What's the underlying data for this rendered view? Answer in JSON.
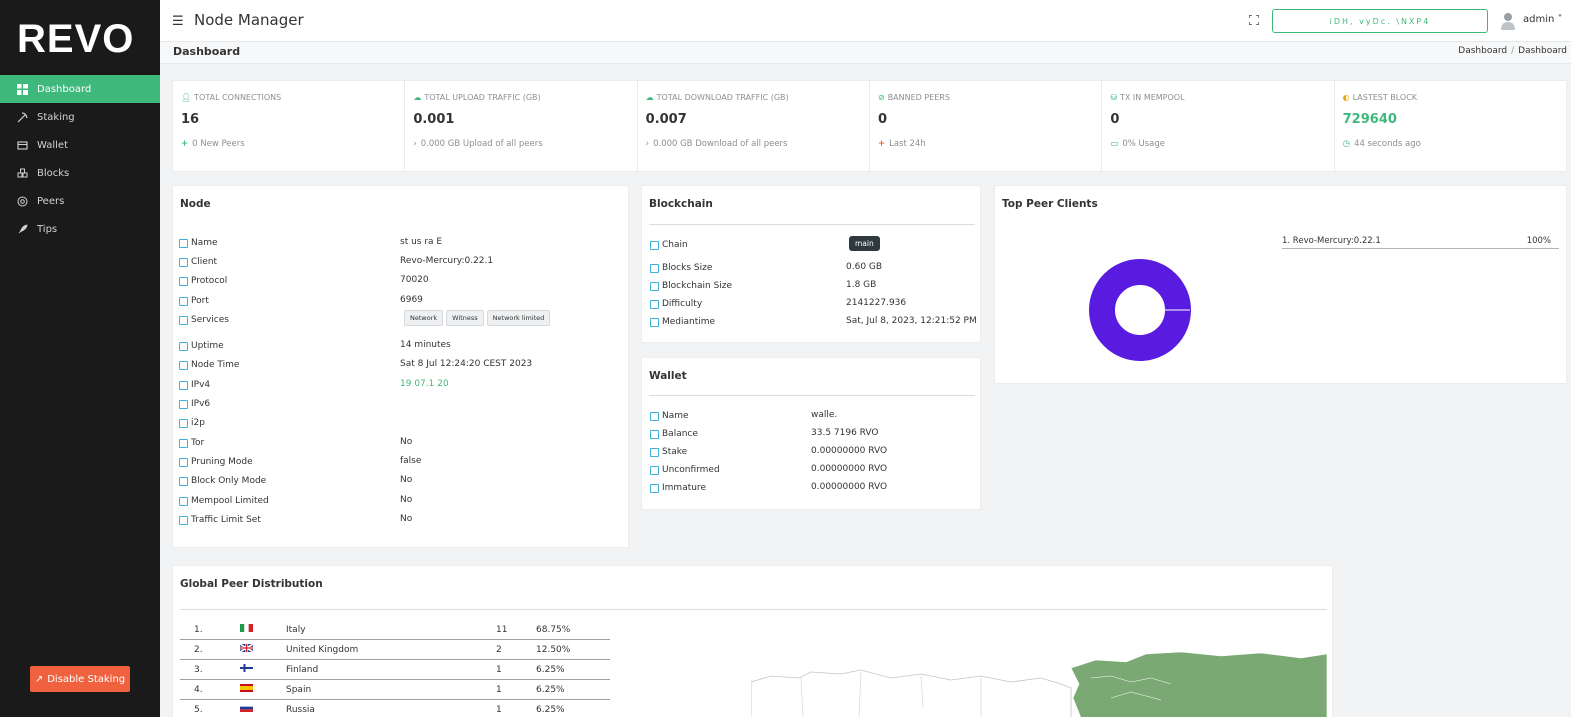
{
  "brand": {
    "logo_text": "REVO"
  },
  "sidebar": {
    "items": [
      {
        "label": "Dashboard",
        "icon": "dashboard-icon"
      },
      {
        "label": "Staking",
        "icon": "pickaxe-icon"
      },
      {
        "label": "Wallet",
        "icon": "wallet-icon"
      },
      {
        "label": "Blocks",
        "icon": "cubes-icon"
      },
      {
        "label": "Peers",
        "icon": "peers-icon"
      },
      {
        "label": "Tips",
        "icon": "rocket-icon"
      }
    ],
    "disable_staking_label": "Disable Staking"
  },
  "header": {
    "title": "Node Manager",
    "address_label": "iDH,  vyDc.    \\NXP4",
    "user": "admin"
  },
  "breadcrumb": {
    "page_title": "Dashboard",
    "crumb1": "Dashboard",
    "crumb2": "Dashboard"
  },
  "stats": [
    {
      "label": "TOTAL CONNECTIONS",
      "value": "16",
      "sub": "0 New Peers"
    },
    {
      "label": "TOTAL UPLOAD TRAFFIC (GB)",
      "value": "0.001",
      "sub": "0.000 GB Upload of all peers"
    },
    {
      "label": "TOTAL DOWNLOAD TRAFFIC (GB)",
      "value": "0.007",
      "sub": "0.000 GB Download of all peers"
    },
    {
      "label": "BANNED PEERS",
      "value": "0",
      "sub": "Last 24h"
    },
    {
      "label": "TX IN MEMPOOL",
      "value": "0",
      "sub": "0% Usage"
    },
    {
      "label": "LASTEST BLOCK",
      "value": "729640",
      "sub": "44 seconds ago"
    }
  ],
  "node": {
    "title": "Node",
    "rows": [
      {
        "label": "Name",
        "value": "st  us  ra  E"
      },
      {
        "label": "Client",
        "value": "Revo-Mercury:0.22.1"
      },
      {
        "label": "Protocol",
        "value": "70020"
      },
      {
        "label": "Port",
        "value": "6969"
      },
      {
        "label": "Services",
        "value": ""
      },
      {
        "label": "Uptime",
        "value": "14 minutes"
      },
      {
        "label": "Node Time",
        "value": "Sat 8 Jul 12:24:20 CEST 2023"
      },
      {
        "label": "IPv4",
        "value": "19   07.1   20"
      },
      {
        "label": "IPv6",
        "value": ""
      },
      {
        "label": "i2p",
        "value": ""
      },
      {
        "label": "Tor",
        "value": "No"
      },
      {
        "label": "Pruning Mode",
        "value": "false"
      },
      {
        "label": "Block Only Mode",
        "value": "No"
      },
      {
        "label": "Mempool Limited",
        "value": "No"
      },
      {
        "label": "Traffic Limit Set",
        "value": "No"
      }
    ],
    "services": [
      "Network",
      "Witness",
      "Network limited"
    ]
  },
  "blockchain": {
    "title": "Blockchain",
    "rows": [
      {
        "label": "Chain",
        "value": "main"
      },
      {
        "label": "Blocks Size",
        "value": "0.60 GB"
      },
      {
        "label": "Blockchain Size",
        "value": "1.8 GB"
      },
      {
        "label": "Difficulty",
        "value": "2141227.936"
      },
      {
        "label": "Mediantime",
        "value": "Sat, Jul 8, 2023, 12:21:52 PM"
      }
    ]
  },
  "wallet": {
    "title": "Wallet",
    "rows": [
      {
        "label": "Name",
        "value": "walle."
      },
      {
        "label": "Balance",
        "value": "33.5     7196 RVO"
      },
      {
        "label": "Stake",
        "value": "0.00000000 RVO"
      },
      {
        "label": "Unconfirmed",
        "value": "0.00000000 RVO"
      },
      {
        "label": "Immature",
        "value": "0.00000000 RVO"
      }
    ]
  },
  "top_peers": {
    "title": "Top Peer Clients",
    "legend_label": "1. Revo-Mercury:0.22.1",
    "legend_pct": "100%",
    "color": "#5a1be0"
  },
  "global": {
    "title": "Global Peer Distribution",
    "rows": [
      {
        "rank": "1.",
        "country": "Italy",
        "count": "11",
        "pct": "68.75%"
      },
      {
        "rank": "2.",
        "country": "United Kingdom",
        "count": "2",
        "pct": "12.50%"
      },
      {
        "rank": "3.",
        "country": "Finland",
        "count": "1",
        "pct": "6.25%"
      },
      {
        "rank": "4.",
        "country": "Spain",
        "count": "1",
        "pct": "6.25%"
      },
      {
        "rank": "5.",
        "country": "Russia",
        "count": "1",
        "pct": "6.25%"
      }
    ]
  },
  "colors": {
    "accent": "#3fb87b",
    "sidebar": "#1a1a1a",
    "danger": "#f0623f",
    "map_land": "#7aa974"
  }
}
